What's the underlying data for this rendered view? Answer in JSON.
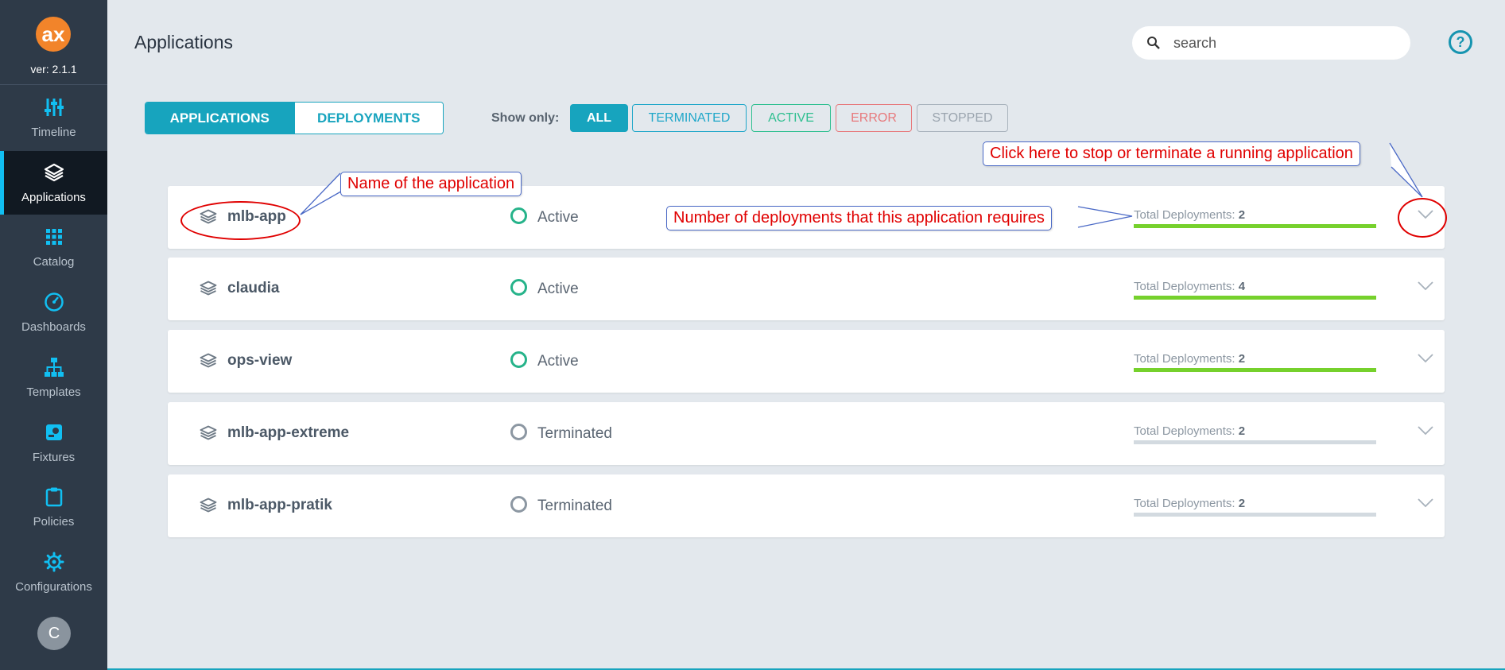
{
  "app": {
    "version": "ver: 2.1.1",
    "logo_text": "ax",
    "logo_color": "#f2842a"
  },
  "sidebar": {
    "items": [
      {
        "label": "Timeline",
        "icon": "sliders-icon"
      },
      {
        "label": "Applications",
        "icon": "layers-icon",
        "active": true
      },
      {
        "label": "Catalog",
        "icon": "grid-icon"
      },
      {
        "label": "Dashboards",
        "icon": "gauge-icon"
      },
      {
        "label": "Templates",
        "icon": "hierarchy-icon"
      },
      {
        "label": "Fixtures",
        "icon": "fixture-icon"
      },
      {
        "label": "Policies",
        "icon": "clipboard-icon"
      },
      {
        "label": "Configurations",
        "icon": "gear-icon"
      }
    ],
    "avatar_initial": "C"
  },
  "header": {
    "title": "Applications",
    "search_placeholder": "search",
    "help_label": "?"
  },
  "tabs": [
    {
      "label": "APPLICATIONS",
      "active": true
    },
    {
      "label": "DEPLOYMENTS",
      "active": false
    }
  ],
  "filters": {
    "label": "Show only:",
    "options": [
      "ALL",
      "TERMINATED",
      "ACTIVE",
      "ERROR",
      "STOPPED"
    ],
    "selected": "ALL"
  },
  "applications": [
    {
      "name": "mlb-app",
      "status": "Active",
      "deployments_label": "Total Deployments:",
      "deployments": "2",
      "progress": 1.0
    },
    {
      "name": "claudia",
      "status": "Active",
      "deployments_label": "Total Deployments:",
      "deployments": "4",
      "progress": 1.0
    },
    {
      "name": "ops-view",
      "status": "Active",
      "deployments_label": "Total Deployments:",
      "deployments": "2",
      "progress": 1.0
    },
    {
      "name": "mlb-app-extreme",
      "status": "Terminated",
      "deployments_label": "Total Deployments:",
      "deployments": "2",
      "progress": 0
    },
    {
      "name": "mlb-app-pratik",
      "status": "Terminated",
      "deployments_label": "Total Deployments:",
      "deployments": "2",
      "progress": 0
    }
  ],
  "annotations": {
    "name": "Name of the application",
    "deployments": "Number of deployments that this application requires",
    "stop": "Click here to stop or terminate a running application"
  },
  "colors": {
    "accent": "#17a4be",
    "sidebar": "#2e3a48",
    "active_status": "#26b38a",
    "progress": "#76d12c",
    "annotation": "#e00000"
  }
}
